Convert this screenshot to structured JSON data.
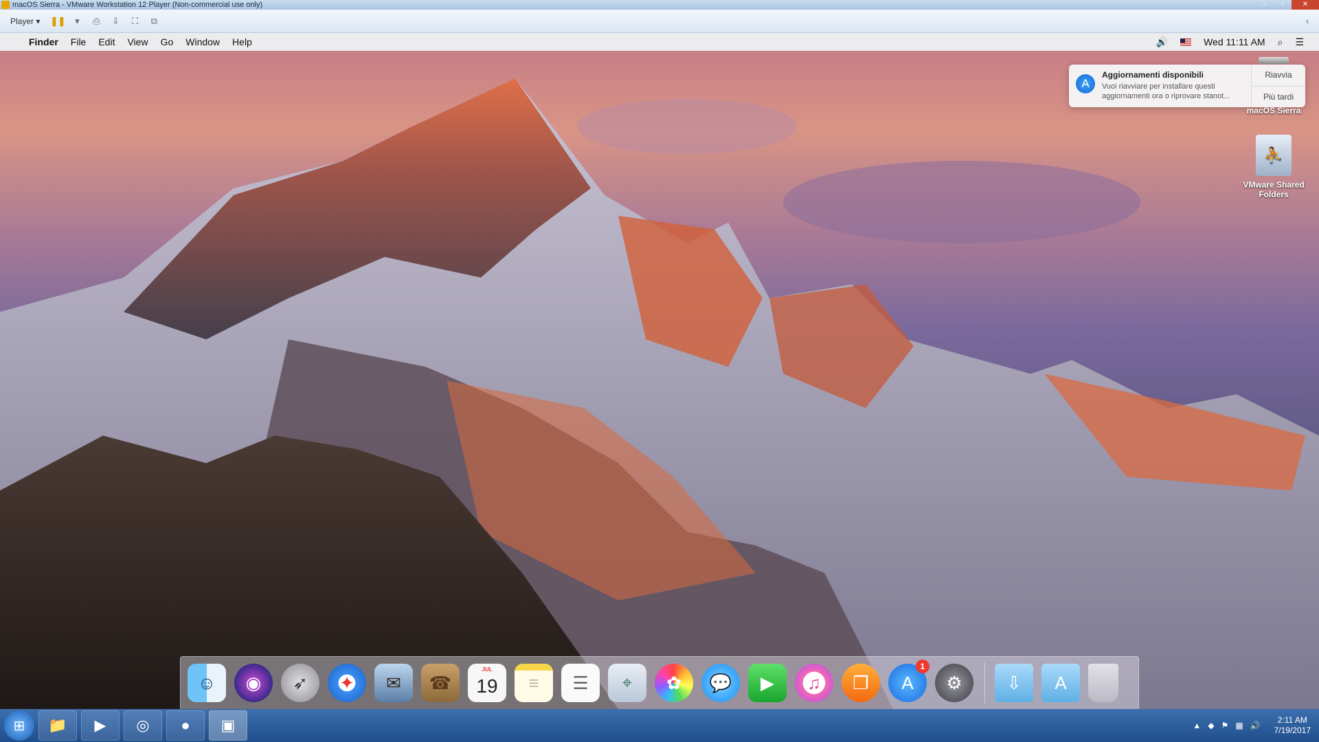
{
  "vmware": {
    "window_title": "macOS Sierra - VMware Workstation 12 Player (Non-commercial use only)",
    "player_label": "Player ▾",
    "win_min": "–",
    "win_max": "▫",
    "win_close": "✕"
  },
  "mac_menubar": {
    "apple_glyph": "",
    "items": [
      "Finder",
      "File",
      "Edit",
      "View",
      "Go",
      "Window",
      "Help"
    ],
    "clock": "Wed 11:11 AM",
    "volume_glyph": "🔊",
    "search_glyph": "⌕",
    "list_glyph": "☰"
  },
  "notification": {
    "title": "Aggiornamenti disponibili",
    "message_line1": "Vuoi riavviare per installare questi",
    "message_line2": "aggiornamenti ora o riprovare stanot...",
    "action_primary": "Riavvia",
    "action_secondary": "Più tardi"
  },
  "desktop_icons": {
    "drive_label": "macOS Sierra",
    "shared_label_line1": "VMware Shared",
    "shared_label_line2": "Folders"
  },
  "dock": {
    "calendar_month": "JUL",
    "calendar_day": "19",
    "appstore_badge": "1"
  },
  "taskbar": {
    "time": "2:11 AM",
    "date": "7/19/2017"
  },
  "colors": {
    "dock_bg": "rgba(225,222,230,0.45)",
    "taskbar": "#1f4e8c",
    "vm_titlebar": "#a9c4e0"
  }
}
